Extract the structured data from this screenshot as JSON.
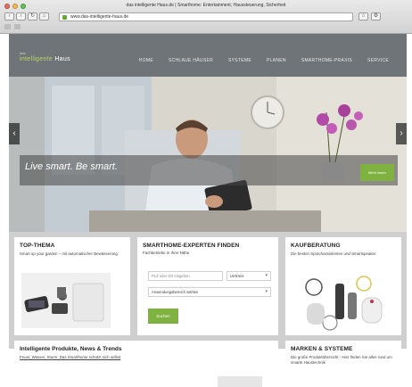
{
  "browser": {
    "window_title": "das intelligente Haus.de  |  Smarthome: Entertainment, Haussteuerung, Sicherheit",
    "url": "www.das-intelligente-haus.de",
    "back_icon": "chevron-left-icon",
    "forward_icon": "chevron-right-icon"
  },
  "site": {
    "logo_top": "das",
    "logo_main": "intelligente",
    "logo_suffix": "Haus",
    "nav": [
      "Home",
      "Schlaue Häuser",
      "Systeme",
      "Planen",
      "Smarthome-Praxis",
      "Service"
    ],
    "colors": {
      "header": "#6f7478",
      "accent": "#7fb241"
    }
  },
  "hero": {
    "tagline": "Live smart. Be smart.",
    "button_label": "Mehr lesen"
  },
  "top_thema": {
    "title": "Top-Thema",
    "text": "Smart up your garden – mit automatischer Bewässerung"
  },
  "experten": {
    "title": "Smarthome-Experten finden",
    "subtitle": "Fachbetriebe in Ihrer Nähe",
    "plz_placeholder": "PLZ oder Ort eingeben",
    "umkreis": "Umkreis",
    "anwendung": "Anwendungsbereich wählen",
    "submit": "Suchen"
  },
  "kaufberatung": {
    "title": "Kaufberatung",
    "text": "Die besten Sprachassistenten und Smartspeaker"
  },
  "produkte": {
    "title": "Intelligente Produkte, News & Trends",
    "link": "Feuer, Wasser, Sturm: Das Smarthome schützt sich selbst"
  },
  "marken": {
    "title": "Marken & Systeme",
    "text": "Die große Produktübersicht - Hier finden Sie alles rund um smarte Haustechnik"
  }
}
